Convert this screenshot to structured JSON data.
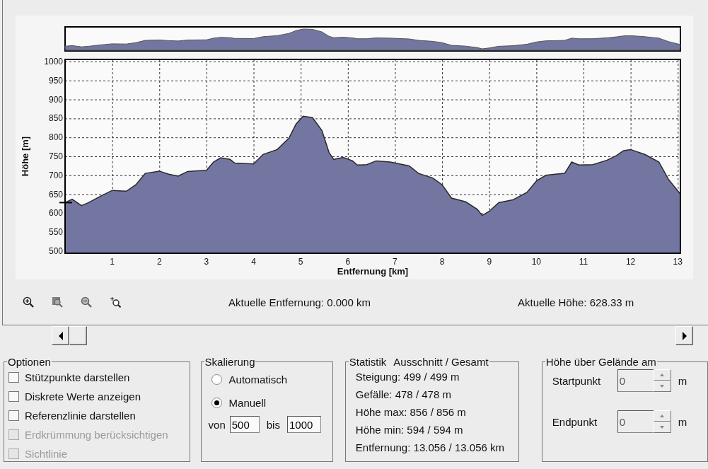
{
  "chart": {
    "chart_data": {
      "type": "area",
      "xlabel": "Entfernung [km]",
      "ylabel": "Höhe [m]",
      "x": [
        0,
        0.15,
        0.35,
        0.5,
        0.75,
        1,
        1.3,
        1.5,
        1.7,
        2,
        2.2,
        2.4,
        2.6,
        2.8,
        3,
        3.15,
        3.3,
        3.5,
        3.6,
        4,
        4.2,
        4.5,
        4.75,
        4.9,
        5.05,
        5.25,
        5.45,
        5.6,
        5.7,
        5.9,
        6.1,
        6.2,
        6.4,
        6.6,
        6.9,
        7.1,
        7.3,
        7.5,
        7.8,
        8,
        8.2,
        8.5,
        8.75,
        8.85,
        9,
        9.2,
        9.5,
        9.8,
        10,
        10.2,
        10.4,
        10.6,
        10.75,
        10.9,
        11.2,
        11.5,
        11.7,
        11.85,
        12,
        12.3,
        12.6,
        12.8,
        13.056
      ],
      "series": [
        {
          "color": "#7276a0",
          "values": [
            628,
            637,
            620,
            628,
            645,
            660,
            658,
            675,
            705,
            711,
            703,
            698,
            710,
            712,
            713,
            735,
            746,
            742,
            732,
            730,
            755,
            768,
            798,
            835,
            856,
            852,
            818,
            760,
            742,
            747,
            738,
            727,
            728,
            738,
            735,
            730,
            725,
            705,
            693,
            675,
            640,
            630,
            610,
            594,
            605,
            628,
            635,
            655,
            685,
            700,
            703,
            705,
            735,
            727,
            728,
            740,
            752,
            765,
            768,
            755,
            735,
            690,
            650
          ]
        }
      ],
      "xlim": [
        0,
        13.056
      ],
      "ylim": [
        500,
        1000
      ],
      "xticks": [
        1,
        2,
        3,
        4,
        5,
        6,
        7,
        8,
        9,
        10,
        11,
        12,
        13
      ],
      "yticks": [
        500,
        550,
        600,
        650,
        700,
        750,
        800,
        850,
        900,
        950,
        1000
      ],
      "grid": true
    }
  },
  "readouts": [
    "Aktuelle Entfernung: 0.000 km",
    "Aktuelle Höhe: 628.33 m"
  ],
  "options": {
    "title": "Optionen",
    "items": [
      {
        "label": "Stützpunkte darstellen",
        "checked": false,
        "disabled": false
      },
      {
        "label": "Diskrete Werte anzeigen",
        "checked": false,
        "disabled": false
      },
      {
        "label": "Referenzlinie darstellen",
        "checked": false,
        "disabled": false
      },
      {
        "label": "Erdkrümmung berücksichtigen",
        "checked": false,
        "disabled": true
      },
      {
        "label": "Sichtlinie",
        "checked": false,
        "disabled": true
      }
    ]
  },
  "scaling": {
    "title": "Skalierung",
    "radios": [
      {
        "label": "Automatisch",
        "selected": false
      },
      {
        "label": "Manuell",
        "selected": true
      }
    ],
    "from_label": "von",
    "from_value": "500",
    "to_label": "bis",
    "to_value": "1000"
  },
  "statistics": {
    "title": "Statistik",
    "subtitle": "Ausschnitt / Gesamt",
    "lines": [
      "Steigung: 499 / 499 m",
      "Gefälle: 478 / 478 m",
      "Höhe max: 856 / 856 m",
      "Höhe min: 594 / 594 m",
      "Entfernung: 13.056 / 13.056 km"
    ]
  },
  "height_above_ground": {
    "title": "Höhe über Gelände am",
    "fields": [
      {
        "label": "Startpunkt",
        "value": "0",
        "unit": "m",
        "disabled": true
      },
      {
        "label": "Endpunkt",
        "value": "0",
        "unit": "m",
        "disabled": true
      }
    ]
  }
}
